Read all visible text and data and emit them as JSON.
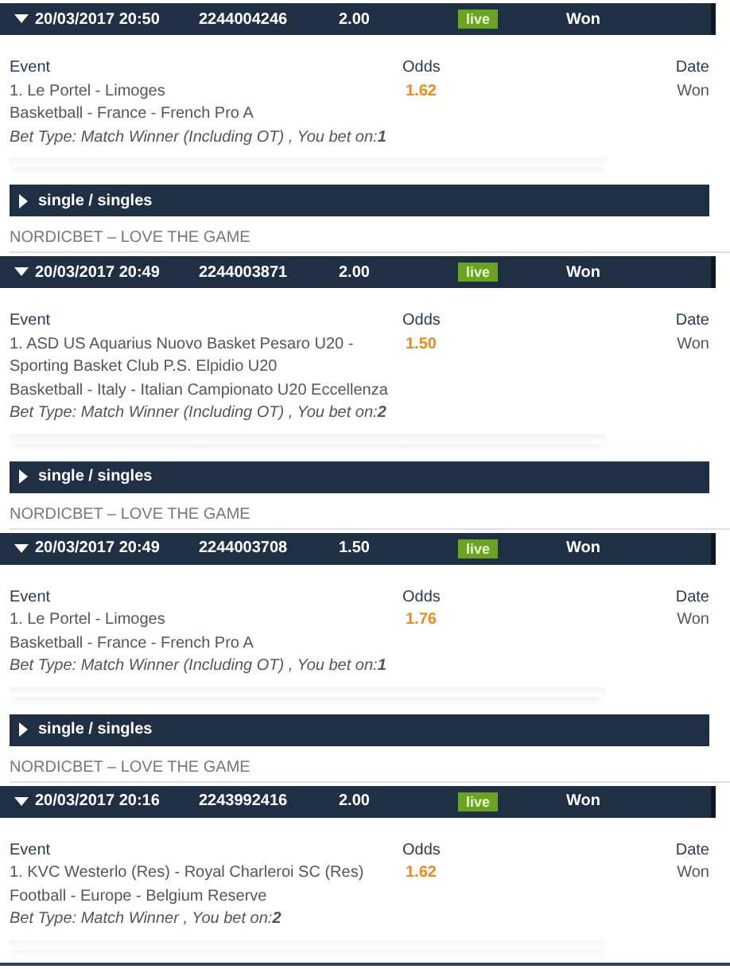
{
  "bets": [
    {
      "date": "20/03/2017 20:50",
      "bet_id": "2244004246",
      "stake": "2.00",
      "badge": "live",
      "status": "Won",
      "expanded": true,
      "headers": {
        "event": "Event",
        "odds": "Odds",
        "date": "Date"
      },
      "event_lines": [
        "1. Le Portel - Limoges"
      ],
      "competition": "Basketball - France - French Pro A",
      "bet_type": "Bet Type: Match Winner (Including OT) , You bet on:**1**",
      "odds": "1.62",
      "result": "Won",
      "group": {
        "label": "single / singles",
        "expanded": false
      },
      "footer": "NORDICBET – LOVE THE GAME"
    },
    {
      "date": "20/03/2017 20:49",
      "bet_id": "2244003871",
      "stake": "2.00",
      "badge": "live",
      "status": "Won",
      "expanded": true,
      "headers": {
        "event": "Event",
        "odds": "Odds",
        "date": "Date"
      },
      "event_lines": [
        "1. ASD US Aquarius Nuovo Basket Pesaro U20 -",
        "Sporting Basket Club P.S. Elpidio U20"
      ],
      "competition": "Basketball - Italy - Italian Campionato U20 Eccellenza",
      "bet_type": "Bet Type: Match Winner (Including OT) , You bet on:**2**",
      "odds": "1.50",
      "result": "Won",
      "group": {
        "label": "single / singles",
        "expanded": false
      },
      "footer": "NORDICBET – LOVE THE GAME"
    },
    {
      "date": "20/03/2017 20:49",
      "bet_id": "2244003708",
      "stake": "1.50",
      "badge": "live",
      "status": "Won",
      "expanded": true,
      "headers": {
        "event": "Event",
        "odds": "Odds",
        "date": "Date"
      },
      "event_lines": [
        "1. Le Portel - Limoges"
      ],
      "competition": "Basketball - France - French Pro A",
      "bet_type": "Bet Type: Match Winner (Including OT) , You bet on:**1**",
      "odds": "1.76",
      "result": "Won",
      "group": {
        "label": "single / singles",
        "expanded": false
      },
      "footer": "NORDICBET – LOVE THE GAME"
    },
    {
      "date": "20/03/2017 20:16",
      "bet_id": "2243992416",
      "stake": "2.00",
      "badge": "live",
      "status": "Won",
      "expanded": true,
      "headers": {
        "event": "Event",
        "odds": "Odds",
        "date": "Date"
      },
      "event_lines": [
        "1. KVC Westerlo (Res) - Royal Charleroi SC (Res)"
      ],
      "competition": "Football - Europe - Belgium Reserve",
      "bet_type": "Bet Type: Match Winner , You bet on:**2**",
      "odds": "1.62",
      "result": "Won"
    }
  ]
}
